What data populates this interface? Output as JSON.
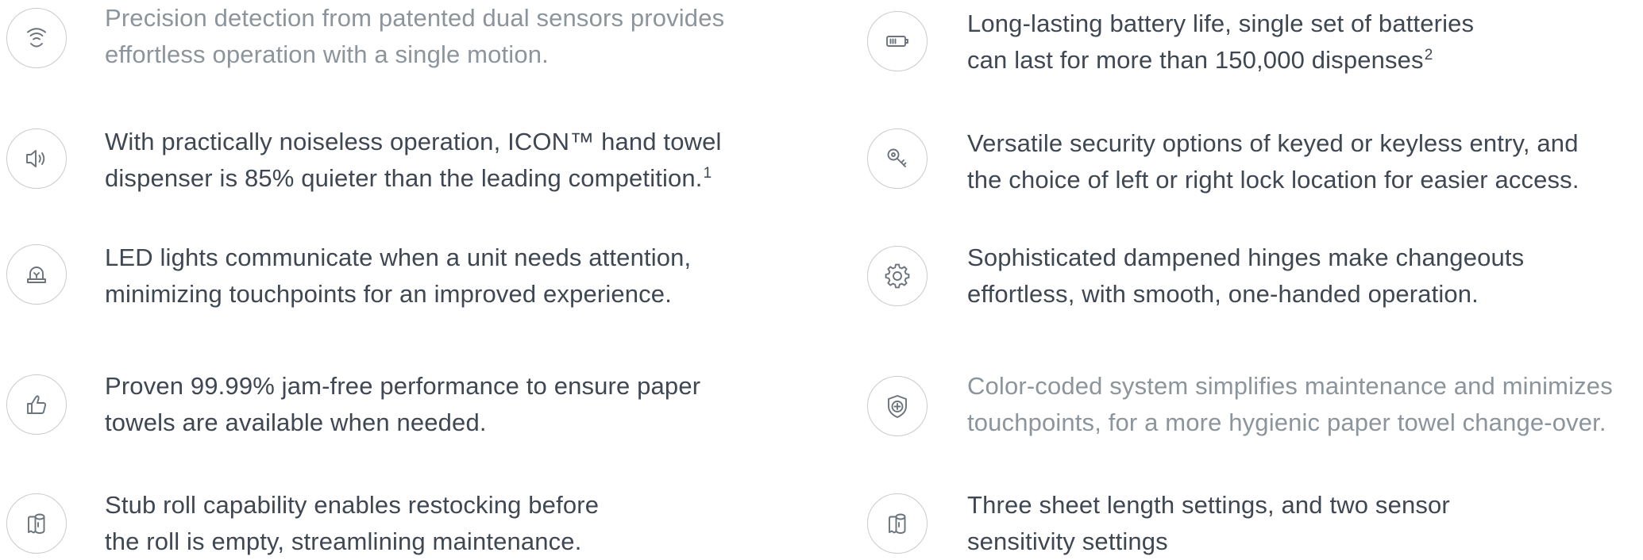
{
  "features": {
    "left": [
      {
        "icon": "sensor-signal-icon",
        "lines": [
          "Precision detection from patented dual sensors provides",
          "effortless operation with a single motion."
        ],
        "sup": "",
        "faded": true
      },
      {
        "icon": "speaker-icon",
        "lines": [
          "With practically noiseless operation, ICON™ hand towel",
          "dispenser is 85% quieter than the leading competition."
        ],
        "sup": "1",
        "faded": false
      },
      {
        "icon": "alert-light-icon",
        "lines": [
          "LED lights communicate when a unit needs attention,",
          "minimizing touchpoints for an improved experience."
        ],
        "sup": "",
        "faded": false
      },
      {
        "icon": "thumbs-up-icon",
        "lines": [
          "Proven 99.99% jam-free performance to ensure paper",
          "towels are available when needed."
        ],
        "sup": "",
        "faded": false
      },
      {
        "icon": "paper-roll-icon",
        "lines": [
          "Stub roll capability enables restocking before",
          "the roll is empty, streamlining maintenance."
        ],
        "sup": "",
        "faded": false
      }
    ],
    "right": [
      {
        "icon": "battery-icon",
        "lines": [
          "Long-lasting battery life, single set of batteries",
          "can last for more than 150,000 dispenses"
        ],
        "sup": "2",
        "faded": false
      },
      {
        "icon": "key-icon",
        "lines": [
          "Versatile security options of keyed or keyless entry, and",
          "the choice of left or right lock location for easier access."
        ],
        "sup": "",
        "faded": false
      },
      {
        "icon": "gear-icon",
        "lines": [
          "Sophisticated dampened hinges make changeouts",
          "effortless, with smooth, one-handed operation."
        ],
        "sup": "",
        "faded": false
      },
      {
        "icon": "shield-plus-icon",
        "lines": [
          "Color-coded system simplifies maintenance and minimizes",
          "touchpoints, for a more hygienic paper towel change-over."
        ],
        "sup": "",
        "faded": true
      },
      {
        "icon": "paper-roll-icon",
        "lines": [
          "Three sheet length settings, and two sensor",
          "sensitivity settings"
        ],
        "sup": "",
        "faded": false
      }
    ]
  },
  "colors": {
    "text": "#3f4752",
    "text_faded": "#8c949c",
    "icon_stroke": "#6b737c",
    "icon_border": "#c7cbd0"
  }
}
